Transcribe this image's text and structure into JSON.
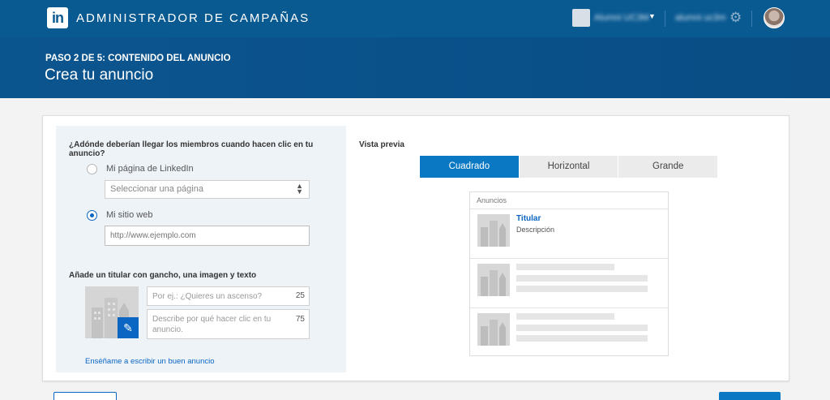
{
  "topbar": {
    "app_title": "ADMINISTRADOR DE CAMPAÑAS",
    "logo_text": "in",
    "account_name": "Alumni UC3M",
    "user_name": "alumni uc3m"
  },
  "header": {
    "step": "PASO 2 DE 5: CONTENIDO DEL ANUNCIO",
    "title": "Crea tu anuncio"
  },
  "form": {
    "destination_question": "¿Adónde deberían llegar los miembros cuando hacen clic en tu anuncio?",
    "option_page_label": "Mi página de LinkedIn",
    "page_select_value": "Seleccionar una página",
    "option_site_label": "Mi sitio web",
    "url_placeholder": "http://www.ejemplo.com",
    "selected_option": "Mi sitio web",
    "content_question": "Añade un titular con gancho, una imagen y texto",
    "headline_placeholder": "Por ej.: ¿Quieres un ascenso?",
    "headline_counter": "25",
    "description_placeholder": "Describe por qué hacer clic en tu anuncio.",
    "description_counter": "75",
    "help_link": "Enséñame a escribir un buen anuncio"
  },
  "preview": {
    "label": "Vista previa",
    "tabs": [
      {
        "label": "Cuadrado",
        "active": true
      },
      {
        "label": "Horizontal",
        "active": false
      },
      {
        "label": "Grande",
        "active": false
      }
    ],
    "ads_header": "Anuncios",
    "ad_title": "Titular",
    "ad_description": "Descripción"
  },
  "colors": {
    "brand_blue": "#0a5a92",
    "accent_blue": "#0a78c2",
    "link_blue": "#0a66c2"
  }
}
